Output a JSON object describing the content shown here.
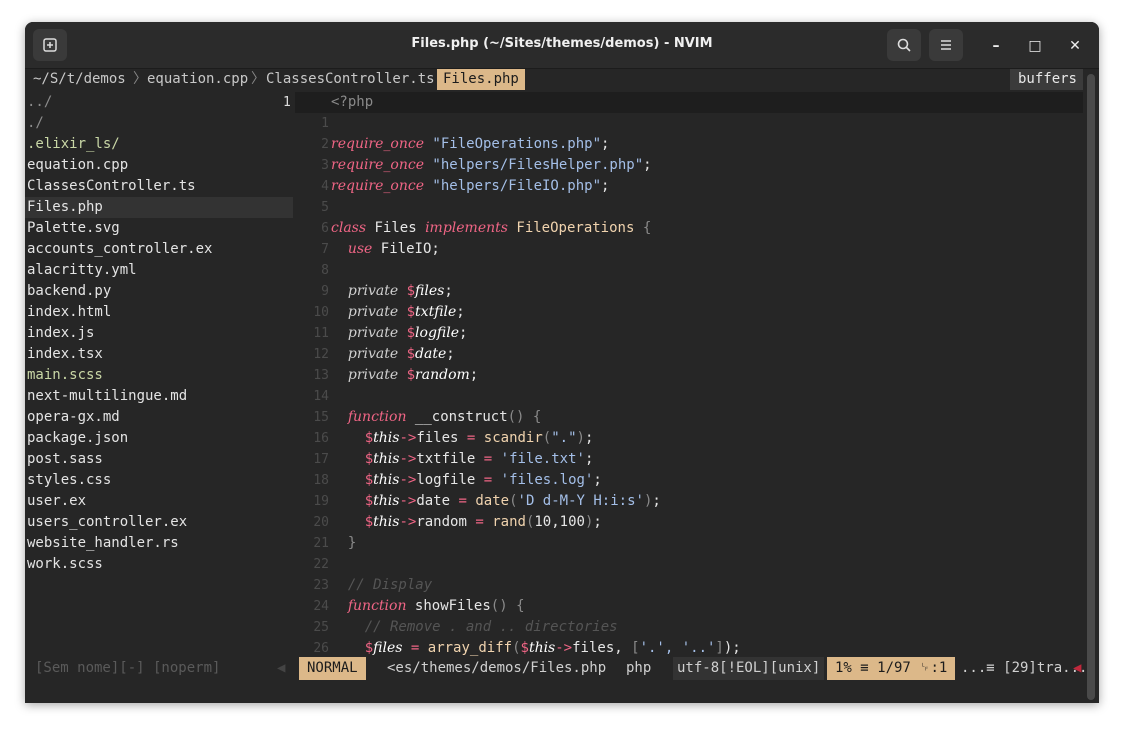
{
  "window": {
    "title": "Files.php (~/Sites/themes/demos) - NVIM",
    "new_tab_icon": "new-tab-icon",
    "search_icon": "search-icon",
    "menu_icon": "hamburger-menu-icon",
    "minimize": "–",
    "maximize": "□",
    "close": "✕"
  },
  "tabline": {
    "tabs": [
      {
        "label": "~/S/t/demos"
      },
      {
        "label": "equation.cpp"
      },
      {
        "label": "ClassesController.ts"
      },
      {
        "label": "Files.php"
      }
    ],
    "separator": "〉",
    "buffers_label": "buffers"
  },
  "tree": {
    "items": [
      {
        "label": "../"
      },
      {
        "label": "./"
      },
      {
        "label": ".elixir_ls/"
      },
      {
        "label": "equation.cpp"
      },
      {
        "label": "ClassesController.ts"
      },
      {
        "label": "Files.php"
      },
      {
        "label": "Palette.svg"
      },
      {
        "label": "accounts_controller.ex"
      },
      {
        "label": "alacritty.yml"
      },
      {
        "label": "backend.py"
      },
      {
        "label": "index.html"
      },
      {
        "label": "index.js"
      },
      {
        "label": "index.tsx"
      },
      {
        "label": "main.scss"
      },
      {
        "label": "next-multilingue.md"
      },
      {
        "label": "opera-gx.md"
      },
      {
        "label": "package.json"
      },
      {
        "label": "post.sass"
      },
      {
        "label": "styles.css"
      },
      {
        "label": "user.ex"
      },
      {
        "label": "users_controller.ex"
      },
      {
        "label": "website_handler.rs"
      },
      {
        "label": "work.scss"
      }
    ]
  },
  "gutter": {
    "current": "1",
    "numbers": [
      "1",
      "2",
      "3",
      "4",
      "5",
      "6",
      "7",
      "8",
      "9",
      "10",
      "11",
      "12",
      "13",
      "14",
      "15",
      "16",
      "17",
      "18",
      "19",
      "20",
      "21",
      "22",
      "23",
      "24",
      "25",
      "26"
    ]
  },
  "code": {
    "l1": "<?php",
    "l3_kw": "require_once",
    "l3_str": "\"FileOperations.php\"",
    "l4_kw": "require_once",
    "l4_str": "\"helpers/FilesHelper.php\"",
    "l5_kw": "require_once",
    "l5_str": "\"helpers/FileIO.php\"",
    "l7_kw1": "class",
    "l7_name": "Files",
    "l7_kw2": "implements",
    "l7_iface": "FileOperations",
    "l8_kw": "use",
    "l8_name": "FileIO",
    "p_kw": "private",
    "v_files": "files",
    "v_txtfile": "txtfile",
    "v_logfile": "logfile",
    "v_date": "date",
    "v_random": "random",
    "l15_kw": "function",
    "l15_name": "__construct",
    "this": "this",
    "arrow": "->",
    "scandir": "scandir",
    "dot": "\".\"",
    "s_file_txt": "'file.txt'",
    "s_files_log": "'files.log'",
    "date_fn": "date",
    "date_fmt": "'D d-M-Y H:i:s'",
    "rand_fn": "rand",
    "rand_args": "10,100",
    "cmt_display": "// Display",
    "l24_name": "showFiles",
    "cmt_remove": "// Remove . and .. directories",
    "array_diff": "array_diff",
    "dots_arr": "'.', '..'"
  },
  "status": {
    "left": "[Sem nome][-] [noperm]",
    "mode": "NORMAL",
    "path": "<es/themes/demos/Files.php",
    "filetype": "php",
    "encoding": "utf-8[!EOL][unix]",
    "position": "1% ≡ 1/97 ␊:1",
    "extra": "...≡ [29]tra..."
  }
}
